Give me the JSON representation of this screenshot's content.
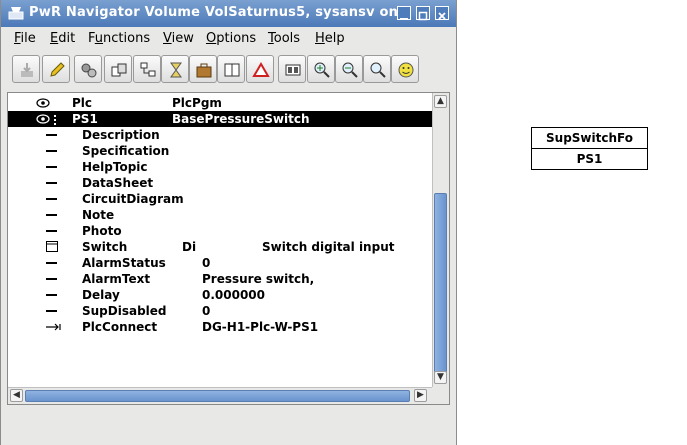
{
  "window": {
    "title": "PwR Navigator Volume VolSaturnus5, sysansv on"
  },
  "menubar": {
    "items": [
      {
        "mnemonic": "F",
        "rest": "ile"
      },
      {
        "mnemonic": "E",
        "rest": "dit"
      },
      {
        "mnemonic": "",
        "pre": "F",
        "rest_u": "u",
        "post": "nctions"
      },
      {
        "mnemonic": "V",
        "rest": "iew"
      },
      {
        "mnemonic": "O",
        "rest": "ptions"
      },
      {
        "mnemonic": "T",
        "rest": "ools"
      },
      {
        "mnemonic": "H",
        "rest": "elp"
      }
    ]
  },
  "toolbar": {
    "buttons": [
      "save-icon",
      "edit-pencil-icon",
      "configure-gears-icon",
      "object-copy-icon",
      "tree-structure-icon",
      "hourglass-icon",
      "briefcase-icon",
      "book-icon",
      "warning-triangle-icon",
      "display-panel-icon",
      "zoom-in-icon",
      "zoom-out-icon",
      "zoom-reset-icon",
      "smiley-icon"
    ]
  },
  "tree": {
    "rows": [
      {
        "icon": "object-icon",
        "name": "Plc",
        "v1": "PlcPgm",
        "v2": ""
      },
      {
        "icon": "object-icon",
        "name": "PS1",
        "v1": "BasePressureSwitch",
        "v2": "",
        "selected": true
      },
      {
        "icon": "attribute-icon",
        "name": "Description",
        "v1": "",
        "v2": ""
      },
      {
        "icon": "attribute-icon",
        "name": "Specification",
        "v1": "",
        "v2": ""
      },
      {
        "icon": "attribute-icon",
        "name": "HelpTopic",
        "v1": "",
        "v2": ""
      },
      {
        "icon": "attribute-icon",
        "name": "DataSheet",
        "v1": "",
        "v2": ""
      },
      {
        "icon": "attribute-icon",
        "name": "CircuitDiagram",
        "v1": "",
        "v2": ""
      },
      {
        "icon": "attribute-icon",
        "name": "Note",
        "v1": "",
        "v2": ""
      },
      {
        "icon": "attribute-icon",
        "name": "Photo",
        "v1": "",
        "v2": ""
      },
      {
        "icon": "object-box-icon",
        "name": "Switch",
        "v1": "Di",
        "v2": "Switch digital input"
      },
      {
        "icon": "attribute-icon",
        "name": "AlarmStatus",
        "v1": "",
        "v2": "0"
      },
      {
        "icon": "attribute-icon",
        "name": "AlarmText",
        "v1": "",
        "v2": "Pressure switch,"
      },
      {
        "icon": "attribute-icon",
        "name": "Delay",
        "v1": "",
        "v2": "0.000000"
      },
      {
        "icon": "attribute-icon",
        "name": "SupDisabled",
        "v1": "",
        "v2": "0"
      },
      {
        "icon": "connect-arrow-icon",
        "name": "PlcConnect",
        "v1": "",
        "v2": "DG-H1-Plc-W-PS1"
      }
    ]
  },
  "function_object": {
    "class": "SupSwitchFo",
    "name": "PS1"
  }
}
